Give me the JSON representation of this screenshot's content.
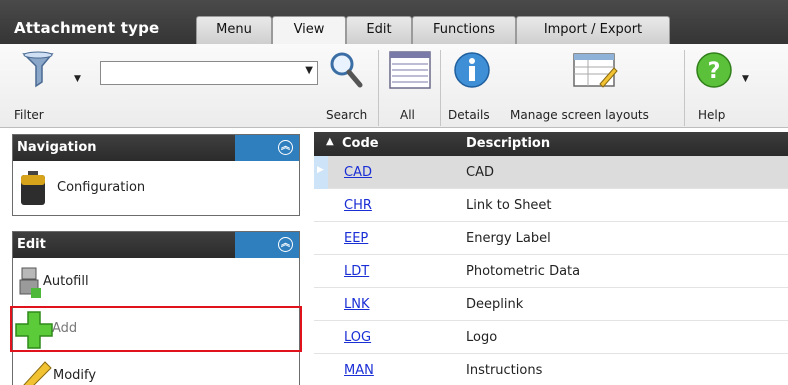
{
  "app": {
    "title": "Attachment type"
  },
  "tabs": [
    {
      "label": "Menu"
    },
    {
      "label": "View"
    },
    {
      "label": "Edit"
    },
    {
      "label": "Functions"
    },
    {
      "label": "Import / Export"
    }
  ],
  "ribbon": {
    "filter_label": "Filter",
    "search_label": "Search",
    "all_label": "All",
    "details_label": "Details",
    "layouts_label": "Manage screen layouts",
    "help_label": "Help",
    "search_value": ""
  },
  "navigation": {
    "title": "Navigation",
    "items": [
      {
        "label": "Configuration"
      }
    ]
  },
  "edit": {
    "title": "Edit",
    "items": [
      {
        "label": "Autofill"
      },
      {
        "label": "Add"
      },
      {
        "label": "Modify"
      }
    ]
  },
  "grid": {
    "columns": [
      {
        "label": "Code"
      },
      {
        "label": "Description"
      }
    ],
    "rows": [
      {
        "code": "CAD",
        "description": "CAD"
      },
      {
        "code": "CHR",
        "description": "Link to Sheet"
      },
      {
        "code": "EEP",
        "description": "Energy Label"
      },
      {
        "code": "LDT",
        "description": "Photometric Data"
      },
      {
        "code": "LNK",
        "description": "Deeplink"
      },
      {
        "code": "LOG",
        "description": "Logo"
      },
      {
        "code": "MAN",
        "description": "Instructions"
      }
    ]
  },
  "colors": {
    "accent": "#2f7fbf",
    "highlight": "#e0121b",
    "link": "#1a2ed6"
  }
}
